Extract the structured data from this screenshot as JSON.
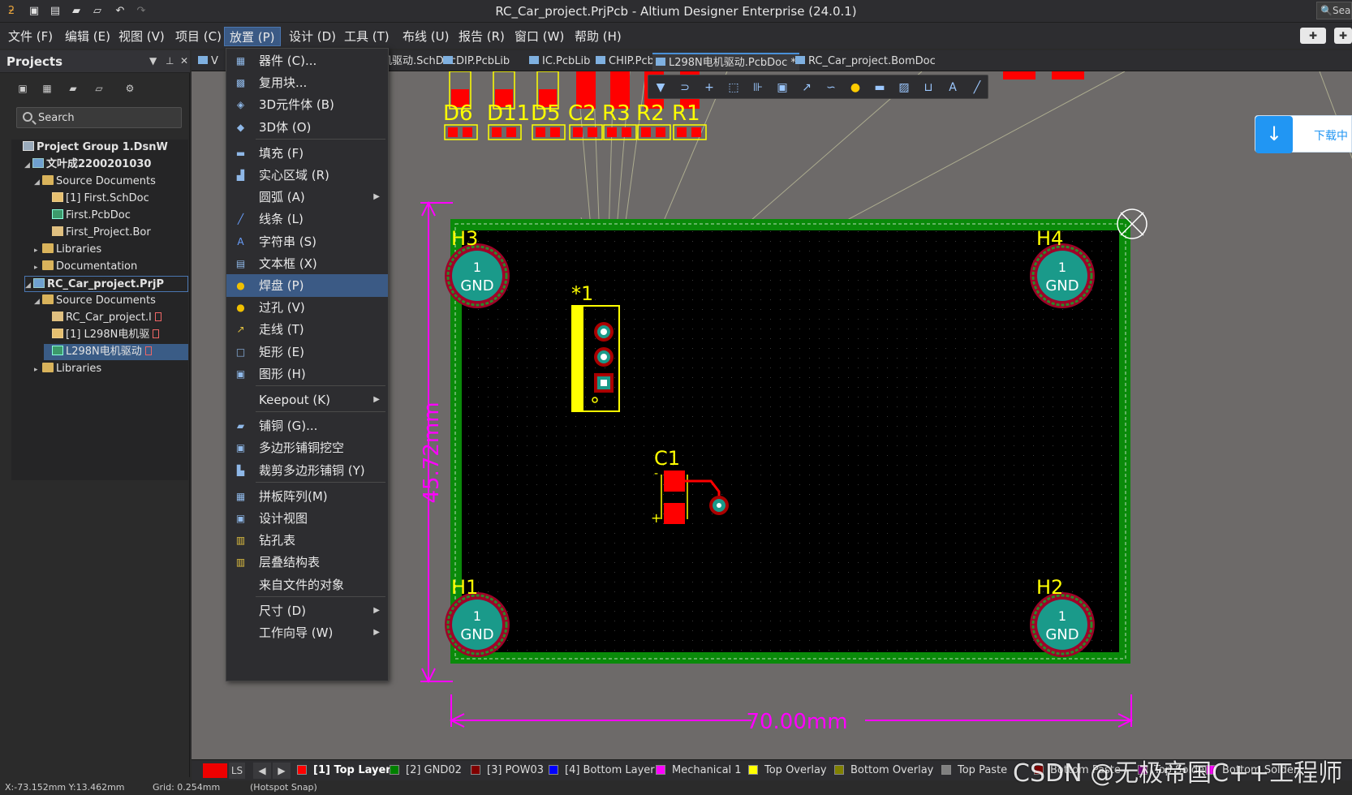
{
  "window": {
    "title": "RC_Car_project.PrjPcb - Altium Designer Enterprise (24.0.1)",
    "search_label": "Sea"
  },
  "menubar": [
    {
      "label": "文件 (F)"
    },
    {
      "label": "编辑 (E)"
    },
    {
      "label": "视图 (V)"
    },
    {
      "label": "项目 (C)"
    },
    {
      "label": "放置 (P)",
      "active": true
    },
    {
      "label": "设计 (D)"
    },
    {
      "label": "工具 (T)"
    },
    {
      "label": "布线 (U)"
    },
    {
      "label": "报告 (R)"
    },
    {
      "label": "窗口 (W)"
    },
    {
      "label": "帮助 (H)"
    }
  ],
  "projects_panel": {
    "title": "Projects",
    "search_placeholder": "Search",
    "tree": [
      {
        "label": "Project Group 1.DsnW",
        "level": 0,
        "icon": "grp",
        "bold": true
      },
      {
        "label": "文叶成2200201030",
        "level": 1,
        "icon": "proj",
        "bold": true,
        "expanded": true
      },
      {
        "label": "Source Documents",
        "level": 2,
        "icon": "folder",
        "expanded": true
      },
      {
        "label": "[1] First.SchDoc",
        "level": 3,
        "icon": "sch"
      },
      {
        "label": "First.PcbDoc",
        "level": 3,
        "icon": "pcb"
      },
      {
        "label": "First_Project.Bor",
        "level": 3,
        "icon": "doc"
      },
      {
        "label": "Libraries",
        "level": 2,
        "icon": "folder",
        "collapsed": true
      },
      {
        "label": "Documentation",
        "level": 2,
        "icon": "folder",
        "collapsed": true
      },
      {
        "label": "RC_Car_project.PrjP",
        "level": 1,
        "icon": "proj",
        "bold": true,
        "expanded": true,
        "highlight": true
      },
      {
        "label": "Source Documents",
        "level": 2,
        "icon": "folder",
        "expanded": true
      },
      {
        "label": "RC_Car_project.l",
        "level": 3,
        "icon": "doc",
        "badge": true
      },
      {
        "label": "[1] L298N电机驱",
        "level": 3,
        "icon": "sch",
        "badge": true
      },
      {
        "label": "L298N电机驱动",
        "level": 3,
        "icon": "pcb",
        "selected": true,
        "badge": true
      },
      {
        "label": "Libraries",
        "level": 2,
        "icon": "folder",
        "collapsed": true
      }
    ]
  },
  "tabs": [
    {
      "label": "V",
      "partial": true
    },
    {
      "label": "机驱动.SchDoc"
    },
    {
      "label": "DIP.PcbLib"
    },
    {
      "label": "IC.PcbLib"
    },
    {
      "label": "CHIP.PcbLib"
    },
    {
      "label": "L298N电机驱动.PcbDoc *",
      "active": true
    },
    {
      "label": "RC_Car_project.BomDoc"
    }
  ],
  "place_menu": [
    {
      "label": "器件 (C)...",
      "icon": "component-icon"
    },
    {
      "label": "复用块...",
      "icon": "reuse-block-icon"
    },
    {
      "label": "3D元件体 (B)",
      "icon": "3d-body-icon"
    },
    {
      "label": "3D体 (O)",
      "icon": "3d-icon"
    },
    {
      "separator": true
    },
    {
      "label": "填充 (F)",
      "icon": "fill-icon"
    },
    {
      "label": "实心区域 (R)",
      "icon": "solid-region-icon"
    },
    {
      "label": "圆弧 (A)",
      "icon": "",
      "submenu": true
    },
    {
      "label": "线条 (L)",
      "icon": "line-icon"
    },
    {
      "label": "字符串 (S)",
      "icon": "string-icon"
    },
    {
      "label": "文本框 (X)",
      "icon": "textbox-icon"
    },
    {
      "label": "焊盘 (P)",
      "icon": "pad-icon",
      "highlighted": true
    },
    {
      "label": "过孔 (V)",
      "icon": "via-icon"
    },
    {
      "label": "走线 (T)",
      "icon": "track-icon"
    },
    {
      "label": "矩形 (E)",
      "icon": "rectangle-icon"
    },
    {
      "label": "图形 (H)",
      "icon": "graphic-icon"
    },
    {
      "separator": true
    },
    {
      "label": "Keepout (K)",
      "icon": "",
      "submenu": true
    },
    {
      "separator": true
    },
    {
      "label": "铺铜 (G)...",
      "icon": "polygon-pour-icon"
    },
    {
      "label": "多边形铺铜挖空",
      "icon": "polygon-cutout-icon"
    },
    {
      "label": "裁剪多边形铺铜 (Y)",
      "icon": "slice-polygon-icon"
    },
    {
      "separator": true
    },
    {
      "label": "拼板阵列(M)",
      "icon": "panel-array-icon"
    },
    {
      "label": "设计视图",
      "icon": "design-view-icon"
    },
    {
      "label": "钻孔表",
      "icon": "drill-table-icon"
    },
    {
      "label": "层叠结构表",
      "icon": "layer-stack-table-icon"
    },
    {
      "label": "来自文件的对象",
      "icon": ""
    },
    {
      "separator": true
    },
    {
      "label": "尺寸 (D)",
      "icon": "",
      "submenu": true
    },
    {
      "label": "工作向导 (W)",
      "icon": "",
      "submenu": true
    }
  ],
  "pcb": {
    "mount_holes": [
      {
        "designator": "H3",
        "pin": "1",
        "net": "GND"
      },
      {
        "designator": "H4",
        "pin": "1",
        "net": "GND"
      },
      {
        "designator": "H1",
        "pin": "1",
        "net": "GND"
      },
      {
        "designator": "H2",
        "pin": "1",
        "net": "GND"
      }
    ],
    "components_top": [
      "D6",
      "D11",
      "D5",
      "C2",
      "R3",
      "R2",
      "R1"
    ],
    "connector_label": "*1",
    "cap_label": "C1",
    "height_dim": "45.72mm",
    "width_dim": "70.00mm"
  },
  "download_badge": {
    "label": "下载中"
  },
  "status": {
    "ls": "LS",
    "layers": [
      {
        "label": "[1] Top Layer",
        "color": "#ff0000",
        "active": true
      },
      {
        "label": "[2] GND02",
        "color": "#008000"
      },
      {
        "label": "[3] POW03",
        "color": "#800000"
      },
      {
        "label": "[4] Bottom Layer",
        "color": "#0000ff"
      },
      {
        "label": "Mechanical 1",
        "color": "#ff00ff"
      },
      {
        "label": "Top Overlay",
        "color": "#ffff00"
      },
      {
        "label": "Bottom Overlay",
        "color": "#808000"
      },
      {
        "label": "Top Paste",
        "color": "#808080"
      },
      {
        "label": "Bottom Paste",
        "color": "#800000"
      },
      {
        "label": "Top Solder",
        "color": "#800080"
      },
      {
        "label": "Bottom Solder",
        "color": "#ff00ff"
      }
    ],
    "coords": "X:-73.152mm Y:13.462mm",
    "grid": "Grid: 0.254mm",
    "snap": "(Hotspot Snap)"
  },
  "watermark": "CSDN @无极帝国C++工程师",
  "colors": {
    "board_fill": "#000000",
    "board_outline": "#0a8a0a",
    "dimension": "#ff00ff",
    "overlay": "#ffff00",
    "pad_red": "#ff0000",
    "menu_highlight": "#3b5a85"
  }
}
